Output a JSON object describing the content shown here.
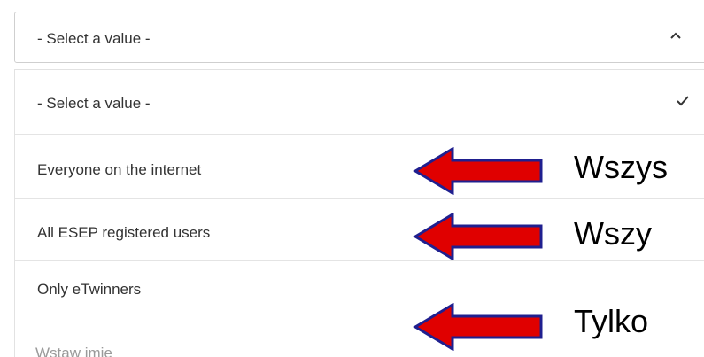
{
  "select": {
    "current_value": "- Select a value -",
    "chevron_icon": "chevron-up-icon"
  },
  "options": [
    {
      "label": "- Select a value -",
      "selected": true
    },
    {
      "label": "Everyone on the internet",
      "selected": false
    },
    {
      "label": "All ESEP registered users",
      "selected": false
    },
    {
      "label": "Only eTwinners",
      "selected": false
    }
  ],
  "background_field": {
    "placeholder_fragment": "Wstaw imię"
  },
  "annotations": {
    "arrow_color": "#e00000",
    "arrow_border_color": "#1f1f8f",
    "labels": [
      "Wszys",
      "Wszy",
      "Tylko"
    ]
  }
}
